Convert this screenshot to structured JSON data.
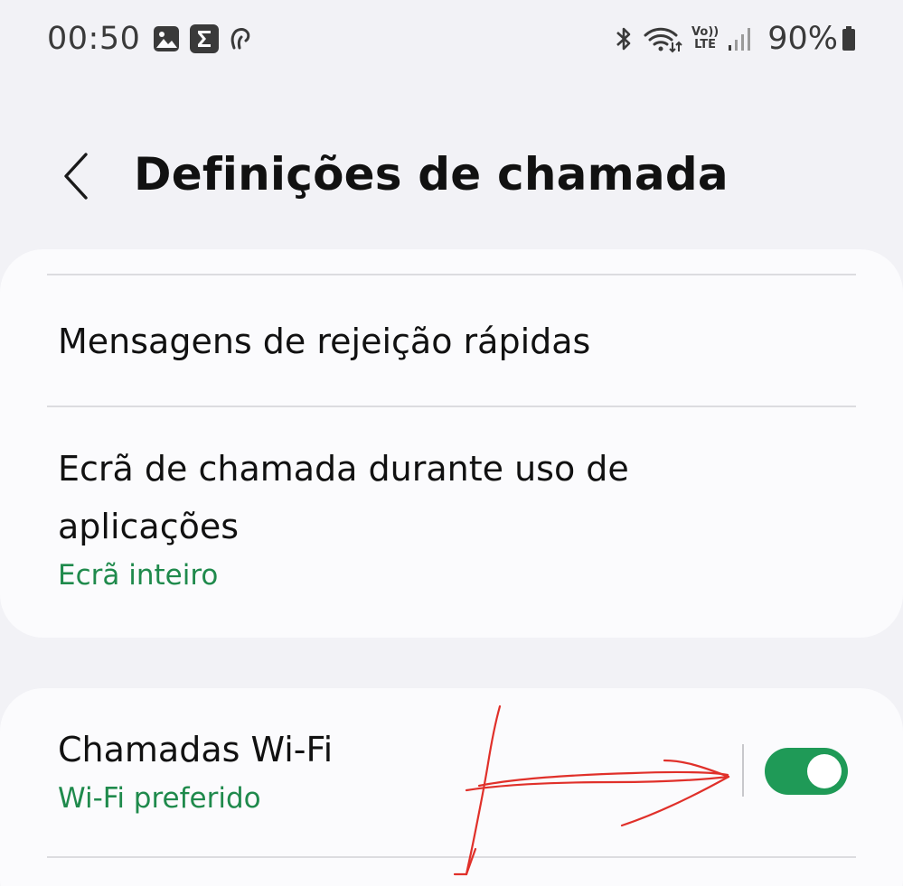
{
  "status_bar": {
    "time": "00:50",
    "battery_percent": "90%",
    "left_icons": [
      "gallery-icon",
      "sigma-app-icon",
      "hearing-aid-icon"
    ],
    "right_icons": [
      "bluetooth-icon",
      "wifi-calling-icon",
      "volte-icon",
      "signal-icon",
      "battery-icon"
    ],
    "volte_label_top": "Vo))",
    "volte_label_bottom": "LTE"
  },
  "header": {
    "title": "Definições de chamada",
    "back_icon": "chevron-left-icon"
  },
  "sections": [
    {
      "items": [
        {
          "title": "Mensagens de rejeição rápidas"
        },
        {
          "title": "Ecrã de chamada durante uso de aplicações",
          "subtitle": "Ecrã inteiro"
        }
      ]
    },
    {
      "items": [
        {
          "title": "Chamadas Wi-Fi",
          "subtitle": "Wi-Fi preferido",
          "toggle_on": true
        }
      ]
    }
  ],
  "colors": {
    "background": "#f2f2f6",
    "card": "#fbfbfd",
    "accent_green": "#1f8a4c",
    "toggle_on": "#1f9a57",
    "annotation_red": "#e0302a"
  }
}
